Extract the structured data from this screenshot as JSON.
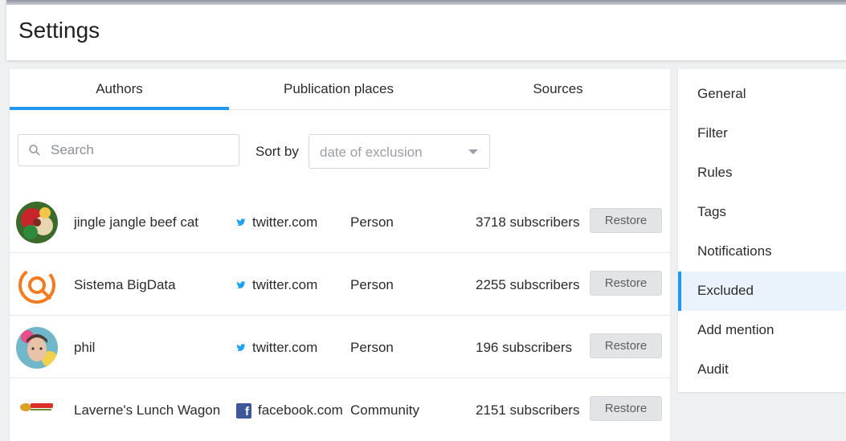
{
  "page": {
    "title": "Settings"
  },
  "tabs": [
    {
      "label": "Authors",
      "active": true
    },
    {
      "label": "Publication places",
      "active": false
    },
    {
      "label": "Sources",
      "active": false
    }
  ],
  "filters": {
    "search_placeholder": "Search",
    "sort_label": "Sort by",
    "sort_value": "date of exclusion"
  },
  "rows": [
    {
      "name": "jingle jangle beef cat",
      "source": "twitter.com",
      "source_icon": "twitter-icon",
      "type": "Person",
      "subscribers": "3718 subscribers",
      "action": "Restore"
    },
    {
      "name": "Sistema BigData",
      "source": "twitter.com",
      "source_icon": "twitter-icon",
      "type": "Person",
      "subscribers": "2255 subscribers",
      "action": "Restore"
    },
    {
      "name": "phil",
      "source": "twitter.com",
      "source_icon": "twitter-icon",
      "type": "Person",
      "subscribers": "196 subscribers",
      "action": "Restore"
    },
    {
      "name": "Laverne's Lunch Wagon",
      "source": "facebook.com",
      "source_icon": "facebook-icon",
      "type": "Community",
      "subscribers": "2151 subscribers",
      "action": "Restore"
    }
  ],
  "menu": [
    {
      "label": "General",
      "active": false
    },
    {
      "label": "Filter",
      "active": false
    },
    {
      "label": "Rules",
      "active": false
    },
    {
      "label": "Tags",
      "active": false
    },
    {
      "label": "Notifications",
      "active": false
    },
    {
      "label": "Excluded",
      "active": true
    },
    {
      "label": "Add mention",
      "active": false
    },
    {
      "label": "Audit",
      "active": false
    }
  ],
  "colors": {
    "accent": "#2196f3",
    "twitter": "#1da1f2",
    "facebook": "#3b5998"
  }
}
